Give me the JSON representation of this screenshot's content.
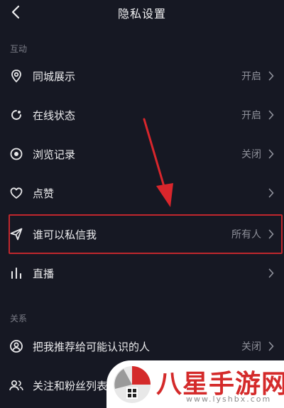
{
  "header": {
    "title": "隐私设置",
    "back_icon": "chevron-left-icon"
  },
  "sections": [
    {
      "label": "互动"
    },
    {
      "label": "关系"
    }
  ],
  "rows": [
    {
      "label": "同城展示",
      "value": "开启",
      "icon": "location-pin-icon"
    },
    {
      "label": "在线状态",
      "value": "开启",
      "icon": "online-status-icon"
    },
    {
      "label": "浏览记录",
      "value": "关闭",
      "icon": "eye-icon"
    },
    {
      "label": "点赞",
      "value": "",
      "icon": "heart-icon"
    },
    {
      "label": "谁可以私信我",
      "value": "所有人",
      "icon": "paper-plane-icon"
    },
    {
      "label": "直播",
      "value": "",
      "icon": "bar-chart-icon"
    },
    {
      "label": "把我推荐给可能认识的人",
      "value": "关闭",
      "icon": "user-circle-icon"
    },
    {
      "label": "关注和粉丝列表",
      "value": "",
      "icon": "users-icon"
    }
  ],
  "watermark": {
    "title": "八星手游网",
    "url": "www.lyshbx.com"
  },
  "colors": {
    "background": "#161823",
    "highlight": "#c0272d",
    "text_secondary": "#8e909a"
  }
}
